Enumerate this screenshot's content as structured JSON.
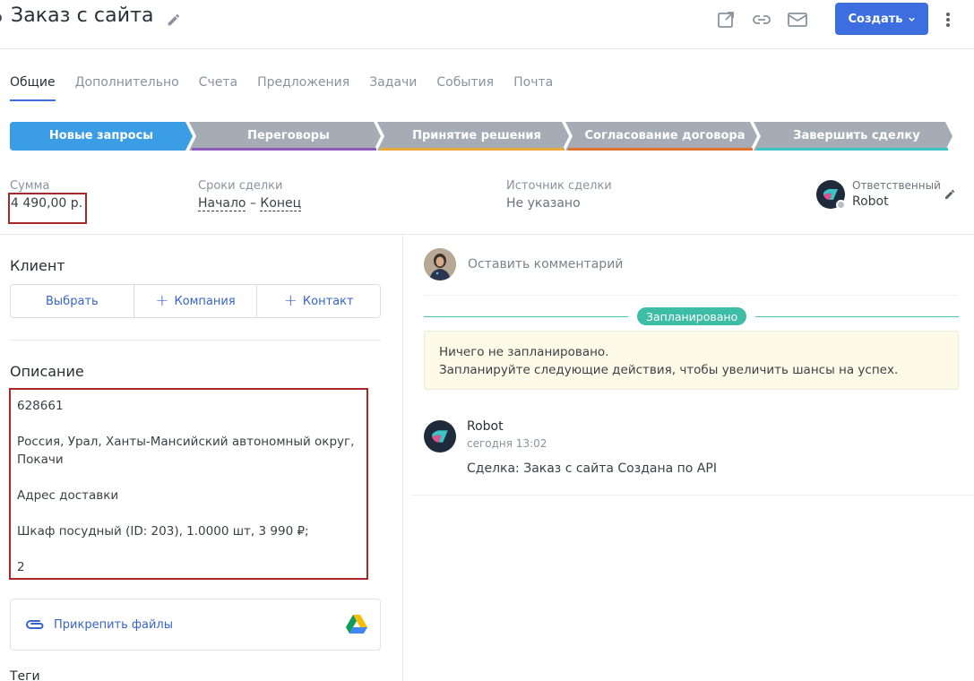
{
  "header": {
    "title": "Заказ с сайта",
    "create_label": "Создать",
    "icons": [
      "edit-icon",
      "external-link-icon",
      "link-icon",
      "mail-icon",
      "more-vertical-icon"
    ]
  },
  "tabs": [
    {
      "label": "Общие",
      "active": true
    },
    {
      "label": "Дополнительно"
    },
    {
      "label": "Счета"
    },
    {
      "label": "Предложения"
    },
    {
      "label": "Задачи"
    },
    {
      "label": "События"
    },
    {
      "label": "Почта"
    }
  ],
  "pipeline": [
    {
      "label": "Новые запросы",
      "color": "#3b9de3",
      "active": true
    },
    {
      "label": "Переговоры",
      "color": "#a5acb6",
      "accent": "#8e5bb8"
    },
    {
      "label": "Принятие решения",
      "color": "#a5acb6",
      "accent": "#e8a93a"
    },
    {
      "label": "Согласование договора",
      "color": "#a5acb6",
      "accent": "#e0722f"
    },
    {
      "label": "Завершить сделку",
      "color": "#a5acb6",
      "accent": "#3cc4c4"
    }
  ],
  "info": {
    "sum_label": "Сумма",
    "sum_value": "4 490,00 р.",
    "terms_label": "Сроки сделки",
    "terms_start": "Начало",
    "terms_sep": "–",
    "terms_end": "Конец",
    "source_label": "Источник сделки",
    "source_value": "Не указано",
    "owner_label": "Ответственный",
    "owner_name": "Robot"
  },
  "client": {
    "title": "Клиент",
    "select_label": "Выбрать",
    "company_label": "Компания",
    "contact_label": "Контакт"
  },
  "description": {
    "title": "Описание",
    "lines": [
      "628661",
      "",
      "Россия, Урал, Ханты-Мансийский автономный округ,",
      "Покачи",
      "",
      "Адрес доставки",
      "",
      "Шкаф посудный (ID: 203), 1.0000 шт, 3 990 ₽;",
      "",
      "2"
    ]
  },
  "attach": {
    "label": "Прикрепить файлы"
  },
  "tags": {
    "title": "Теги"
  },
  "feed": {
    "comment_placeholder": "Оставить комментарий",
    "planned_badge": "Запланировано",
    "empty_line1": "Ничего не запланировано.",
    "empty_line2": "Запланируйте следующие действия, чтобы увеличить шансы на успех.",
    "event_author": "Robot",
    "event_time": "сегодня 13:02",
    "event_text": "Сделка: Заказ с сайта Создана по API"
  },
  "colors": {
    "primary": "#3d6ee0",
    "highlight_border": "#a72828",
    "planned": "#3dbca6"
  }
}
